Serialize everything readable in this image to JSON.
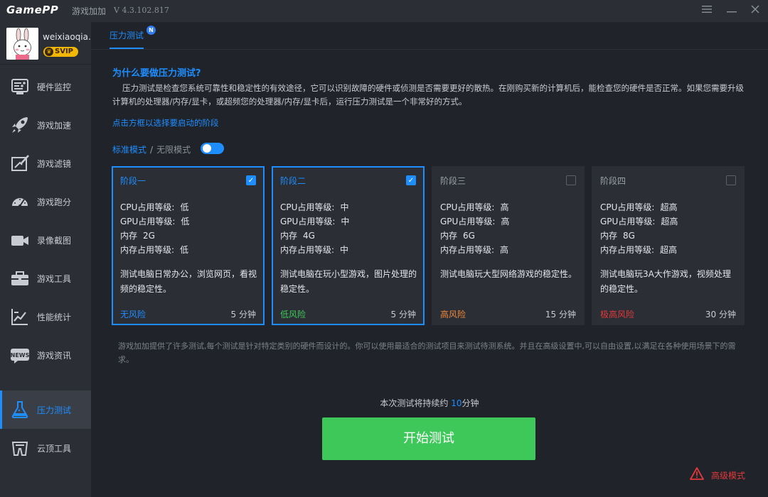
{
  "titlebar": {
    "logo": "GamePP",
    "app_name": "游戏加加",
    "version": "V 4.3.102.817",
    "menu_icon": "menu-icon",
    "minimize_icon": "minimize-icon",
    "close_icon": "close-icon"
  },
  "user": {
    "name": "weixiaoqia..",
    "badge": "SVIP"
  },
  "sidebar": {
    "items": [
      {
        "label": "硬件监控",
        "icon": "hardware-monitor-icon"
      },
      {
        "label": "游戏加速",
        "icon": "rocket-icon"
      },
      {
        "label": "游戏滤镜",
        "icon": "filter-icon"
      },
      {
        "label": "游戏跑分",
        "icon": "speedometer-icon"
      },
      {
        "label": "录像截图",
        "icon": "camera-icon"
      },
      {
        "label": "游戏工具",
        "icon": "toolbox-icon"
      },
      {
        "label": "性能统计",
        "icon": "chart-icon"
      },
      {
        "label": "游戏资讯",
        "icon": "news-icon"
      },
      {
        "label": "压力测试",
        "icon": "flask-icon",
        "active": true
      },
      {
        "label": "云顶工具",
        "icon": "cloud-tool-icon"
      }
    ]
  },
  "main": {
    "tab": "压力测试",
    "tab_badge": "N",
    "question": "为什么要做压力测试?",
    "description": "压力测试是检查您系统可靠性和稳定性的有效途径，它可以识别故障的硬件或侦测是否需要更好的散热。在刚购买新的计算机后，能检查您的硬件是否正常。如果您需要升级计算机的处理器/内存/显卡，或超频您的处理器/内存/显卡后，运行压力测试是一个非常好的方式。",
    "hint": "点击方框以选择要启动的阶段",
    "mode_standard": "标准模式",
    "mode_separator": "/",
    "mode_infinite": "无限模式",
    "footnote": "游戏加加提供了许多测试,每个测试是针对特定类别的硬件而设计的。你可以使用最适合的测试项目来测试待测系统。并且在高级设置中,可以自由设置,以满足在各种使用场景下的需求。",
    "duration_prefix": "本次测试将持续约",
    "duration_value": "10",
    "duration_unit": "分钟",
    "start_button": "开始测试",
    "advanced": "高级模式"
  },
  "stages": [
    {
      "name": "阶段一",
      "checked": true,
      "cpu_label": "CPU占用等级:",
      "cpu": "低",
      "gpu_label": "GPU占用等级:",
      "gpu": "低",
      "mem_label": "内存",
      "mem": "2G",
      "memuse_label": "内存占用等级:",
      "memuse": "低",
      "desc": "测试电脑日常办公，浏览网页，看视频的稳定性。",
      "risk": "无风险",
      "risk_color": "#1e8eff",
      "duration": "5 分钟"
    },
    {
      "name": "阶段二",
      "checked": true,
      "cpu_label": "CPU占用等级:",
      "cpu": "中",
      "gpu_label": "GPU占用等级:",
      "gpu": "中",
      "mem_label": "内存",
      "mem": "4G",
      "memuse_label": "内存占用等级:",
      "memuse": "中",
      "desc": "测试电脑在玩小型游戏，图片处理的稳定性。",
      "risk": "低风险",
      "risk_color": "#3ec85a",
      "duration": "5 分钟"
    },
    {
      "name": "阶段三",
      "checked": false,
      "cpu_label": "CPU占用等级:",
      "cpu": "高",
      "gpu_label": "GPU占用等级:",
      "gpu": "高",
      "mem_label": "内存",
      "mem": "6G",
      "memuse_label": "内存占用等级:",
      "memuse": "高",
      "desc": "测试电脑玩大型网络游戏的稳定性。",
      "risk": "高风险",
      "risk_color": "#f0883a",
      "duration": "15 分钟"
    },
    {
      "name": "阶段四",
      "checked": false,
      "cpu_label": "CPU占用等级:",
      "cpu": "超高",
      "gpu_label": "GPU占用等级:",
      "gpu": "超高",
      "mem_label": "内存",
      "mem": "8G",
      "memuse_label": "内存占用等级:",
      "memuse": "超高",
      "desc": "测试电脑玩3A大作游戏，视频处理的稳定性。",
      "risk": "极高风险",
      "risk_color": "#e23a3a",
      "duration": "30 分钟"
    }
  ],
  "colors": {
    "accent": "#1e8eff",
    "start": "#3ec85a",
    "danger": "#e23a3a"
  }
}
